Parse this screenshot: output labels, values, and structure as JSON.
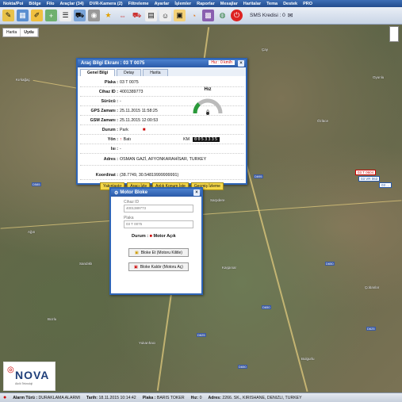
{
  "menu": [
    "Nokta/Poi",
    "Bölge",
    "Filo",
    "Araçlar (34)",
    "DVR-Kamera (2)",
    "Filtreleme",
    "Ayarlar",
    "İşlemler",
    "Raporlar",
    "Mesajlar",
    "Haritalar",
    "Tema",
    "Destek",
    "PRO"
  ],
  "toolbar": {
    "sms_label": "SMS Kredisi : 0"
  },
  "map_tabs": [
    "Harita",
    "Uydu"
  ],
  "places": [
    "Kırkağaç",
    "Çay",
    "Oyunlu",
    "Sandıklı",
    "Özlüce",
    "Sarpdere",
    "Ağın",
    "Bulgurlu",
    "Çobanlar",
    "Yukarıhacı",
    "Kaşpınar",
    "Bozlu"
  ],
  "roads": [
    "D650",
    "D695",
    "D650",
    "D625",
    "D650",
    "D585",
    "D650",
    "D625"
  ],
  "vehicle_tags": [
    "03 T 0604",
    "03 VR 063",
    "03 ..."
  ],
  "vehicle_window": {
    "title": "Araç Bilgi Ekranı : 03 T 0075",
    "speed_badge": "Hız : 0 km/h",
    "tabs": [
      "Genel Bilgi",
      "Detay",
      "Harita"
    ],
    "rows": [
      {
        "label": "Plaka :",
        "value": "03 T 0075"
      },
      {
        "label": "Cihaz ID :",
        "value": "4001389773"
      },
      {
        "label": "Sürücü :",
        "value": "-"
      },
      {
        "label": "GPS Zamanı :",
        "value": "25.11.2015 11:58:25"
      },
      {
        "label": "GSM Zamanı :",
        "value": "25.11.2015 12:00:53"
      },
      {
        "label": "Durum :",
        "value": "Park"
      },
      {
        "label": "Yön :",
        "value": "Batı"
      },
      {
        "label": "Isı :",
        "value": "-"
      },
      {
        "label": "Adres :",
        "value": "OSMAN GAZİ, AFYONKARAHİSAR, TURKEY"
      },
      {
        "label": "Koordinat :",
        "value": "(38.7749, 30.54819999999991)"
      }
    ],
    "gauge_label": "Hız",
    "gauge_value": "0",
    "km_label": "KM",
    "km_value": "0053335",
    "buttons": [
      "Yakınlaştır",
      "Aracı İzle",
      "Anlık Konum İste",
      "Geçmiş İzleme"
    ]
  },
  "motor_window": {
    "title": "Motor Bloke",
    "device_label": "Cihaz ID",
    "device_value": "4001389773",
    "plate_label": "Plaka",
    "plate_value": "03 T 0075",
    "status_label": "Durum :",
    "status_value": "Motor Açık",
    "btn_lock": "Bloke Et (Motoru Kilitle)",
    "btn_unlock": "Bloke Kaldır (Motoru Aç)"
  },
  "logo": {
    "brand": "NOVA",
    "sub": "Akıllı Teknoloji"
  },
  "status": {
    "alarm_label": "Alarm Türü :",
    "alarm_value": "DURAKLAMA ALARMI",
    "date_label": "Tarih:",
    "date_value": "18.11.2015 10:14:42",
    "plate_label": "Plaka :",
    "plate_value": "BARIS TOKER",
    "speed_label": "Hız:",
    "speed_value": "0",
    "addr_label": "Adres:",
    "addr_value": "2266. SK., KIRISHANE, DENIZLI, TURKEY"
  },
  "colors": {
    "accent": "#2e64b5",
    "button_yellow": "#f5d84a",
    "alarm_red": "#c00000"
  }
}
